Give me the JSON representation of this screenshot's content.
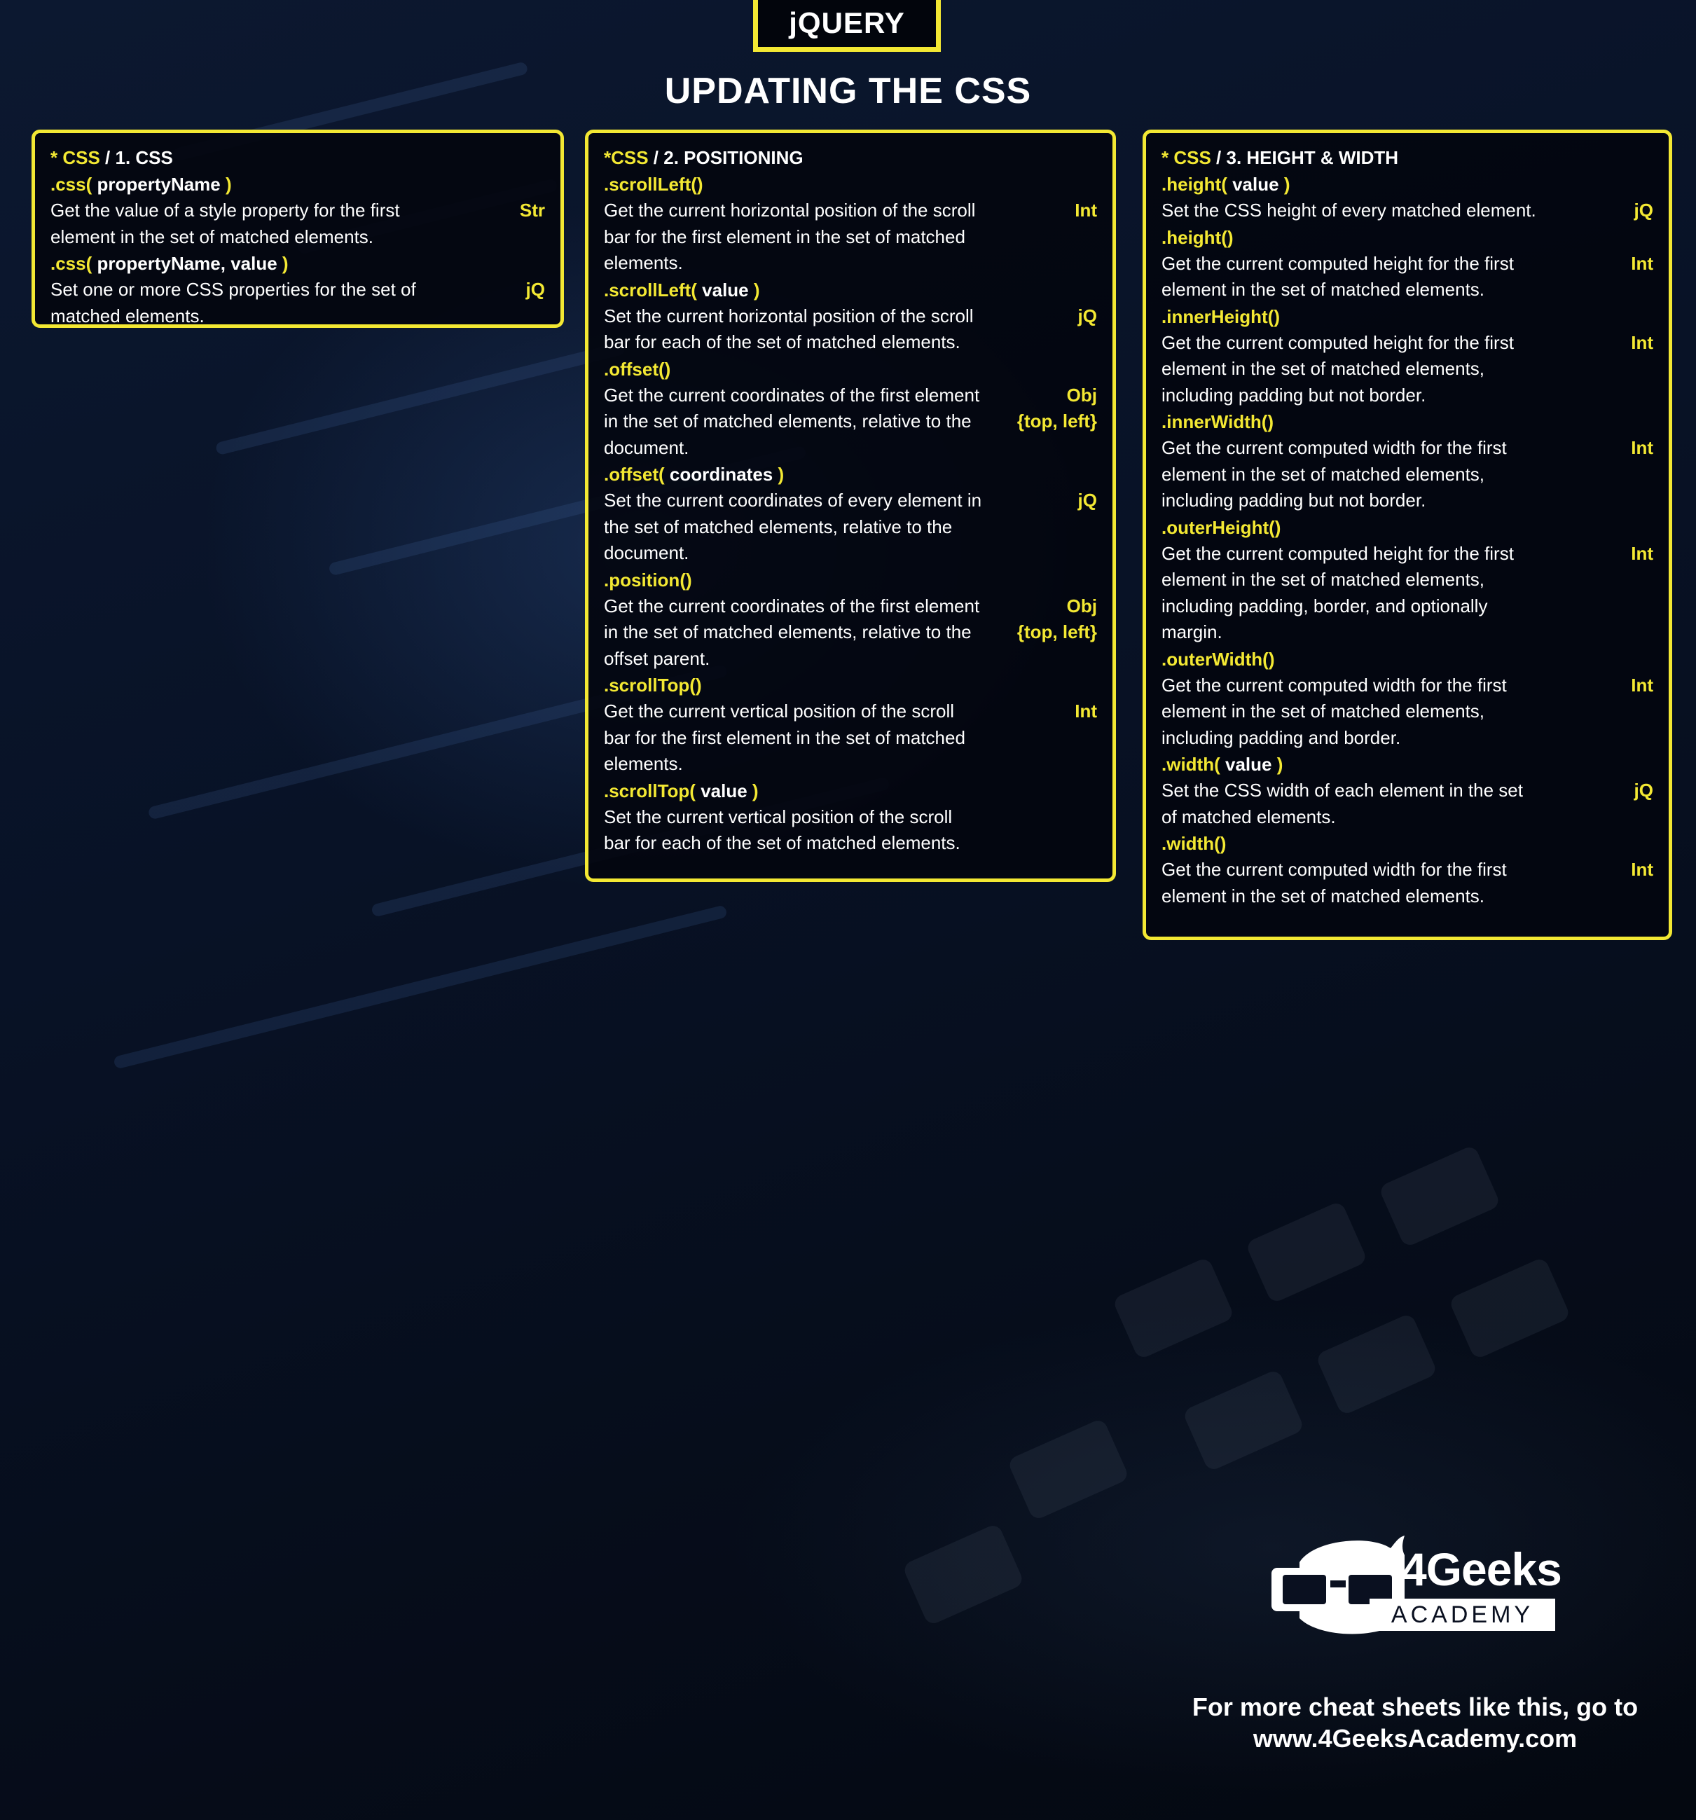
{
  "badge": "jQUERY",
  "title": "UPDATING THE CSS",
  "sections": [
    {
      "heading_prefix": "* CSS",
      "heading_rest": " / 1. CSS",
      "entries": [
        {
          "method": ".css(",
          "param": " propertyName ",
          "close": ")",
          "description": "Get the value of a style property for the first element in the set of matched elements.",
          "returns": "Str"
        },
        {
          "method": ".css(",
          "param": " propertyName, value ",
          "close": ")",
          "description": "Set one or more CSS properties for the set of matched elements.",
          "returns": "jQ"
        }
      ]
    },
    {
      "heading_prefix": "*CSS",
      "heading_rest": " / 2. POSITIONING",
      "entries": [
        {
          "method": ".scrollLeft()",
          "param": "",
          "close": "",
          "description": "Get the current horizontal position of the scroll bar for the first element in the set of matched elements.",
          "returns": "Int"
        },
        {
          "method": ".scrollLeft(",
          "param": " value ",
          "close": ")",
          "description": "Set the current horizontal position of the scroll bar for each of the set of matched elements.",
          "returns": "jQ"
        },
        {
          "method": ".offset()",
          "param": "",
          "close": "",
          "description": "Get the current coordinates of the first element in the set of matched elements, relative to the document.",
          "returns": "Obj",
          "returns_extra": "{top, left}"
        },
        {
          "method": ".offset(",
          "param": " coordinates ",
          "close": ")",
          "description": "Set the current coordinates of every element in the set of matched elements, relative to the document.",
          "returns": "jQ"
        },
        {
          "method": ".position()",
          "param": "",
          "close": "",
          "description": "Get the current coordinates of the first element in the set of matched elements, relative to the offset parent.",
          "returns": "Obj",
          "returns_extra": "{top, left}"
        },
        {
          "method": ".scrollTop()",
          "param": "",
          "close": "",
          "description": "Get the current vertical position of the scroll bar for the first element in the set of matched elements.",
          "returns": "Int"
        },
        {
          "method": ".scrollTop(",
          "param": " value ",
          "close": ")",
          "description": "Set the current vertical position of the scroll bar for each of the set of matched elements.",
          "returns": ""
        }
      ]
    },
    {
      "heading_prefix": "* CSS",
      "heading_rest": " / 3. HEIGHT & WIDTH",
      "entries": [
        {
          "method": ".height(",
          "param": " value ",
          "close": ")",
          "description": "Set the CSS height of every matched element.",
          "returns": "jQ"
        },
        {
          "method": ".height()",
          "param": "",
          "close": "",
          "description": "Get the current computed height for the first element in the set of matched elements.",
          "returns": "Int"
        },
        {
          "method": ".innerHeight()",
          "param": "",
          "close": "",
          "description": "Get the current computed height for the first element in the set of matched elements, including padding but not border.",
          "returns": "Int"
        },
        {
          "method": ".innerWidth()",
          "param": "",
          "close": "",
          "description": "Get the current computed width for the first element in the set of matched elements, including padding but not border.",
          "returns": "Int"
        },
        {
          "method": ".outerHeight()",
          "param": "",
          "close": "",
          "description": "Get the current computed height for the first element in the set of matched elements, including padding, border, and optionally margin.",
          "returns": "Int"
        },
        {
          "method": ".outerWidth()",
          "param": "",
          "close": "",
          "description": "Get the current computed width for the first element in the set of matched elements, including padding and border.",
          "returns": "Int"
        },
        {
          "method": ".width(",
          "param": " value ",
          "close": ")",
          "description": "Set the CSS width of each element in the set of matched elements.",
          "returns": "jQ"
        },
        {
          "method": ".width()",
          "param": "",
          "close": "",
          "description": "Get the current computed width for the first element in the set of matched elements.",
          "returns": "Int"
        }
      ]
    }
  ],
  "logo": {
    "word": "4Geeks",
    "sub": "ACADEMY"
  },
  "footer": {
    "line1": "For more cheat sheets like this, go to",
    "line2": "www.4GeeksAcademy.com"
  },
  "colors": {
    "accent": "#f3e833",
    "background": "#060b16",
    "text": "#ffffff"
  }
}
